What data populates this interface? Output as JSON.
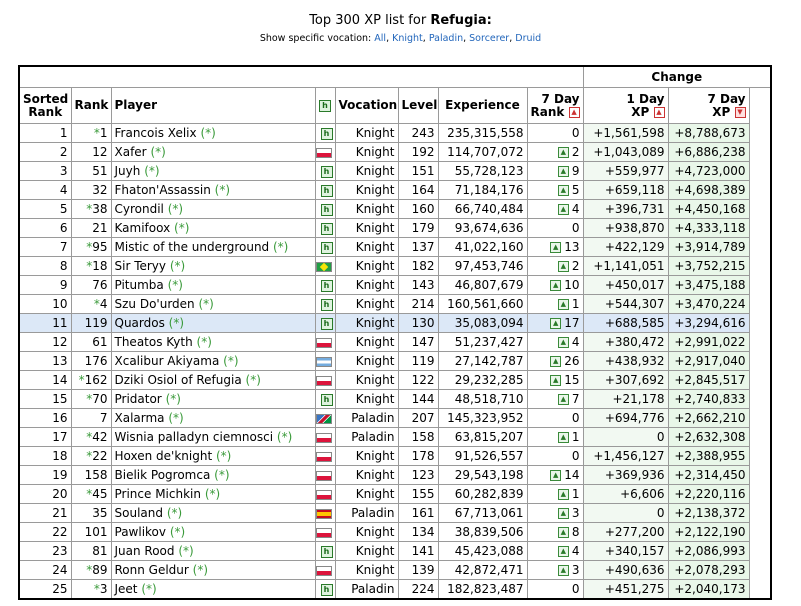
{
  "header": {
    "title_prefix": "Top 300 XP list for ",
    "world": "Refugia:",
    "vocation_prompt": "Show specific vocation: ",
    "vocations": [
      "All",
      "Knight",
      "Paladin",
      "Sorcerer",
      "Druid"
    ]
  },
  "table": {
    "change_group": "Change",
    "columns": {
      "sorted_rank_1": "Sorted",
      "sorted_rank_2": "Rank",
      "rank": "Rank",
      "player": "Player",
      "hiscore_icon": "h",
      "vocation": "Vocation",
      "level": "Level",
      "experience": "Experience",
      "rank7_1": "7 Day",
      "rank7_2": "Rank",
      "xp1_1": "1 Day",
      "xp1_2": "XP",
      "xp7_1": "7 Day",
      "xp7_2": "XP"
    },
    "star": "*",
    "suffix_link": "(*)",
    "highlight_row": 11,
    "rows": [
      {
        "sorted": "1",
        "rank_star": true,
        "rank": "1",
        "player": "Francois Xelix",
        "flag": "",
        "voc": "Knight",
        "level": "243",
        "exp": "235,315,558",
        "r7": "0",
        "r7up": false,
        "d1": "+1,561,598",
        "d7": "+8,788,673"
      },
      {
        "sorted": "2",
        "rank_star": false,
        "rank": "12",
        "player": "Xafer",
        "flag": "pl",
        "voc": "Knight",
        "level": "192",
        "exp": "114,707,072",
        "r7": "2",
        "r7up": true,
        "d1": "+1,043,089",
        "d7": "+6,886,238"
      },
      {
        "sorted": "3",
        "rank_star": false,
        "rank": "51",
        "player": "Juyh",
        "flag": "",
        "voc": "Knight",
        "level": "151",
        "exp": "55,728,123",
        "r7": "9",
        "r7up": true,
        "d1": "+559,977",
        "d7": "+4,723,000"
      },
      {
        "sorted": "4",
        "rank_star": false,
        "rank": "32",
        "player": "Fhaton'Assassin",
        "flag": "",
        "voc": "Knight",
        "level": "164",
        "exp": "71,184,176",
        "r7": "5",
        "r7up": true,
        "d1": "+659,118",
        "d7": "+4,698,389"
      },
      {
        "sorted": "5",
        "rank_star": true,
        "rank": "38",
        "player": "Cyrondil",
        "flag": "",
        "voc": "Knight",
        "level": "160",
        "exp": "66,740,484",
        "r7": "4",
        "r7up": true,
        "d1": "+396,731",
        "d7": "+4,450,168"
      },
      {
        "sorted": "6",
        "rank_star": false,
        "rank": "21",
        "player": "Kamifoox",
        "flag": "",
        "voc": "Knight",
        "level": "179",
        "exp": "93,674,636",
        "r7": "0",
        "r7up": false,
        "d1": "+938,870",
        "d7": "+4,333,118"
      },
      {
        "sorted": "7",
        "rank_star": true,
        "rank": "95",
        "player": "Mistic of the underground",
        "flag": "",
        "voc": "Knight",
        "level": "137",
        "exp": "41,022,160",
        "r7": "13",
        "r7up": true,
        "d1": "+422,129",
        "d7": "+3,914,789"
      },
      {
        "sorted": "8",
        "rank_star": true,
        "rank": "18",
        "player": "Sir Teryy",
        "flag": "br",
        "voc": "Knight",
        "level": "182",
        "exp": "97,453,746",
        "r7": "2",
        "r7up": true,
        "d1": "+1,141,051",
        "d7": "+3,752,215"
      },
      {
        "sorted": "9",
        "rank_star": false,
        "rank": "76",
        "player": "Pitumba",
        "flag": "",
        "voc": "Knight",
        "level": "143",
        "exp": "46,807,679",
        "r7": "10",
        "r7up": true,
        "d1": "+450,017",
        "d7": "+3,475,188"
      },
      {
        "sorted": "10",
        "rank_star": true,
        "rank": "4",
        "player": "Szu Do'urden",
        "flag": "",
        "voc": "Knight",
        "level": "214",
        "exp": "160,561,660",
        "r7": "1",
        "r7up": true,
        "d1": "+544,307",
        "d7": "+3,470,224"
      },
      {
        "sorted": "11",
        "rank_star": false,
        "rank": "119",
        "player": "Quardos",
        "flag": "",
        "voc": "Knight",
        "level": "130",
        "exp": "35,083,094",
        "r7": "17",
        "r7up": true,
        "d1": "+688,585",
        "d7": "+3,294,616"
      },
      {
        "sorted": "12",
        "rank_star": false,
        "rank": "61",
        "player": "Theatos Kyth",
        "flag": "pl",
        "voc": "Knight",
        "level": "147",
        "exp": "51,237,427",
        "r7": "4",
        "r7up": true,
        "d1": "+380,472",
        "d7": "+2,991,022"
      },
      {
        "sorted": "13",
        "rank_star": false,
        "rank": "176",
        "player": "Xcalibur Akiyama",
        "flag": "ar",
        "voc": "Knight",
        "level": "119",
        "exp": "27,142,787",
        "r7": "26",
        "r7up": true,
        "d1": "+438,932",
        "d7": "+2,917,040"
      },
      {
        "sorted": "14",
        "rank_star": true,
        "rank": "162",
        "player": "Dziki Osiol of Refugia",
        "flag": "pl",
        "voc": "Knight",
        "level": "122",
        "exp": "29,232,285",
        "r7": "15",
        "r7up": true,
        "d1": "+307,692",
        "d7": "+2,845,517"
      },
      {
        "sorted": "15",
        "rank_star": true,
        "rank": "70",
        "player": "Pridator",
        "flag": "",
        "voc": "Knight",
        "level": "144",
        "exp": "48,518,710",
        "r7": "7",
        "r7up": true,
        "d1": "+21,178",
        "d7": "+2,740,833"
      },
      {
        "sorted": "16",
        "rank_star": false,
        "rank": "7",
        "player": "Xalarma",
        "flag": "na",
        "voc": "Paladin",
        "level": "207",
        "exp": "145,323,952",
        "r7": "0",
        "r7up": false,
        "d1": "+694,776",
        "d7": "+2,662,210"
      },
      {
        "sorted": "17",
        "rank_star": true,
        "rank": "42",
        "player": "Wisnia palladyn ciemnosci",
        "flag": "pl",
        "voc": "Paladin",
        "level": "158",
        "exp": "63,815,207",
        "r7": "1",
        "r7up": true,
        "d1": "0",
        "d7": "+2,632,308"
      },
      {
        "sorted": "18",
        "rank_star": true,
        "rank": "22",
        "player": "Hoxen de'knight",
        "flag": "pl",
        "voc": "Knight",
        "level": "178",
        "exp": "91,526,557",
        "r7": "0",
        "r7up": false,
        "d1": "+1,456,127",
        "d7": "+2,388,955"
      },
      {
        "sorted": "19",
        "rank_star": false,
        "rank": "158",
        "player": "Bielik Pogromca",
        "flag": "pl",
        "voc": "Knight",
        "level": "123",
        "exp": "29,543,198",
        "r7": "14",
        "r7up": true,
        "d1": "+369,936",
        "d7": "+2,314,450"
      },
      {
        "sorted": "20",
        "rank_star": true,
        "rank": "45",
        "player": "Prince Michkin",
        "flag": "pl",
        "voc": "Knight",
        "level": "155",
        "exp": "60,282,839",
        "r7": "1",
        "r7up": true,
        "d1": "+6,606",
        "d7": "+2,220,116"
      },
      {
        "sorted": "21",
        "rank_star": false,
        "rank": "35",
        "player": "Souland",
        "flag": "es",
        "voc": "Paladin",
        "level": "161",
        "exp": "67,713,061",
        "r7": "3",
        "r7up": true,
        "d1": "0",
        "d7": "+2,138,372"
      },
      {
        "sorted": "22",
        "rank_star": false,
        "rank": "101",
        "player": "Pawlikov",
        "flag": "pl",
        "voc": "Knight",
        "level": "134",
        "exp": "38,839,506",
        "r7": "8",
        "r7up": true,
        "d1": "+277,200",
        "d7": "+2,122,190"
      },
      {
        "sorted": "23",
        "rank_star": false,
        "rank": "81",
        "player": "Juan Rood",
        "flag": "",
        "voc": "Knight",
        "level": "141",
        "exp": "45,423,088",
        "r7": "4",
        "r7up": true,
        "d1": "+340,157",
        "d7": "+2,086,993"
      },
      {
        "sorted": "24",
        "rank_star": true,
        "rank": "89",
        "player": "Ronn Geldur",
        "flag": "pl",
        "voc": "Knight",
        "level": "139",
        "exp": "42,872,471",
        "r7": "3",
        "r7up": true,
        "d1": "+490,636",
        "d7": "+2,078,293"
      },
      {
        "sorted": "25",
        "rank_star": true,
        "rank": "3",
        "player": "Jeet",
        "flag": "",
        "voc": "Paladin",
        "level": "224",
        "exp": "182,823,487",
        "r7": "0",
        "r7up": false,
        "d1": "+451,275",
        "d7": "+2,040,173"
      }
    ]
  }
}
